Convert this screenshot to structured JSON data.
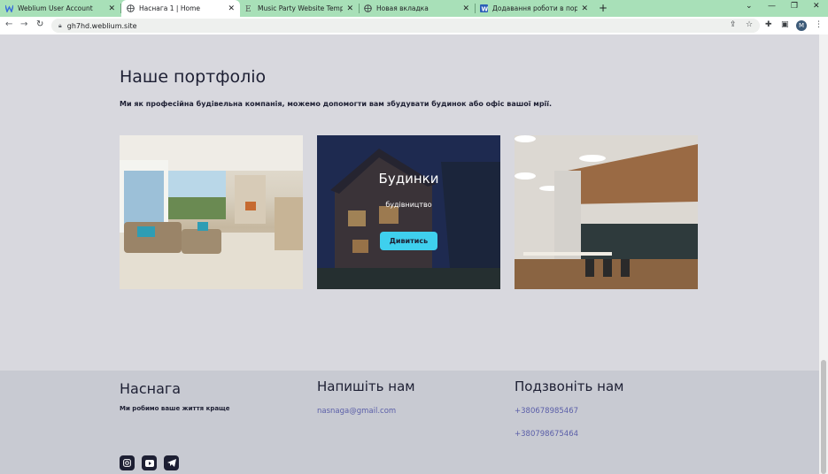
{
  "browser": {
    "tabs": [
      {
        "title": "Weblium User Account",
        "icon": "weblium-logo-icon"
      },
      {
        "title": "Наснага 1 | Home",
        "icon": "globe-icon"
      },
      {
        "title": "Music Party Website Template Di",
        "icon": "elementor-icon"
      },
      {
        "title": "Новая вкладка",
        "icon": "globe-icon"
      },
      {
        "title": "Додавання роботи в портфоліо",
        "icon": "word-icon"
      }
    ],
    "url": "gh7hd.weblium.site",
    "avatar_letter": "M",
    "accent": "#a8e0b8"
  },
  "portfolio": {
    "title": "Наше портфоліо",
    "subtitle": "Ми як професійна будівельна компанія, можемо допомогти вам збудувати будинок або офіс вашої мрії.",
    "cards": [
      {
        "image": "living-room-interior"
      },
      {
        "image": "house-exterior-night",
        "title": "Будинки",
        "sub": "будівництво",
        "button": "Дивитись"
      },
      {
        "image": "office-interior"
      }
    ],
    "button_color": "#3fd0ee"
  },
  "footer": {
    "brand": "Наснага",
    "tagline": "Ми робимо ваше життя краще",
    "write_title": "Напишіть нам",
    "email": "nasnaga@gmail.com",
    "call_title": "Подзвоніть нам",
    "phone1": "+380678985467",
    "phone2": "+380798675464",
    "social": [
      "instagram-icon",
      "youtube-icon",
      "telegram-icon"
    ]
  }
}
